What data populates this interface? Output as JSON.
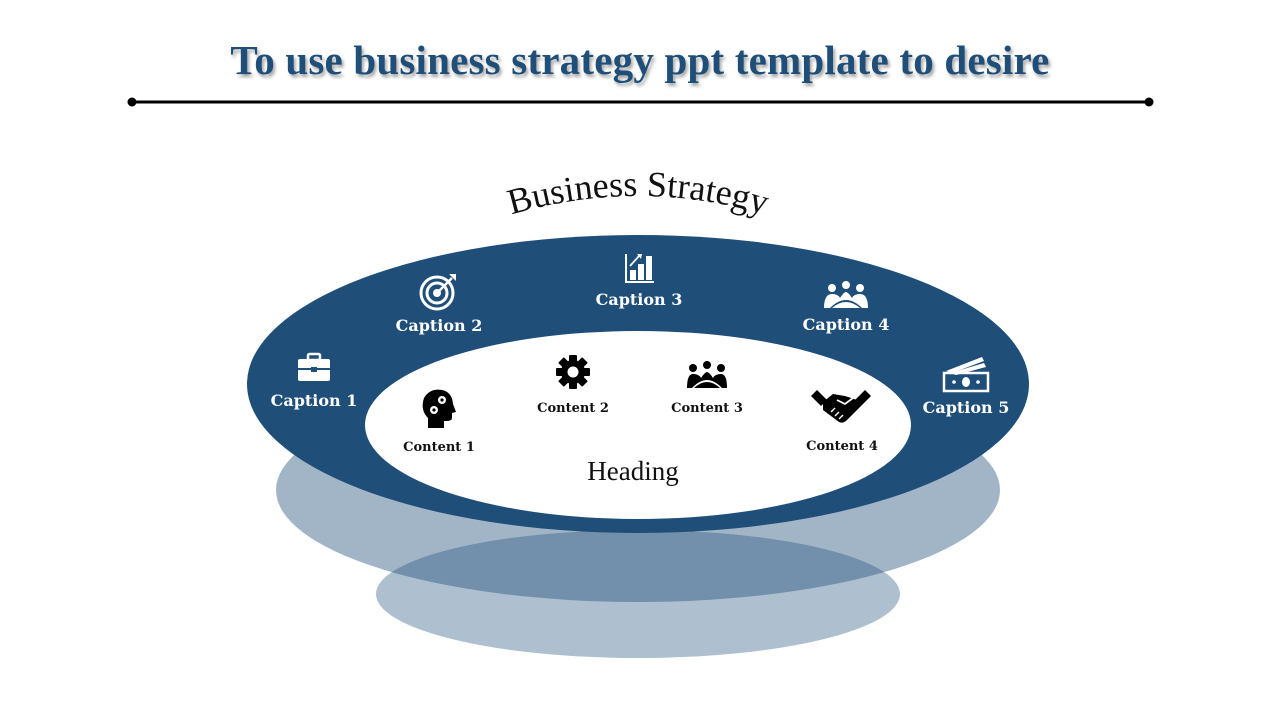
{
  "slide": {
    "title": "To use business strategy ppt template to desire",
    "arc_title": "Business Strategy",
    "heading": "Heading",
    "colors": {
      "primary": "#1f4e79",
      "ring_lower": "#a0b4c8",
      "ring_lowest": "#8aa3bc",
      "inner": "#ffffff",
      "caption_text": "#ffffff",
      "content_text": "#111111"
    },
    "captions": [
      {
        "label": "Caption 1",
        "icon": "briefcase-icon"
      },
      {
        "label": "Caption 2",
        "icon": "target-icon"
      },
      {
        "label": "Caption 3",
        "icon": "bar-chart-icon"
      },
      {
        "label": "Caption 4",
        "icon": "meeting-icon"
      },
      {
        "label": "Caption 5",
        "icon": "money-icon"
      }
    ],
    "contents": [
      {
        "label": "Content 1",
        "icon": "head-gears-icon"
      },
      {
        "label": "Content 2",
        "icon": "gear-icon"
      },
      {
        "label": "Content 3",
        "icon": "team-icon"
      },
      {
        "label": "Content 4",
        "icon": "handshake-icon"
      }
    ]
  }
}
